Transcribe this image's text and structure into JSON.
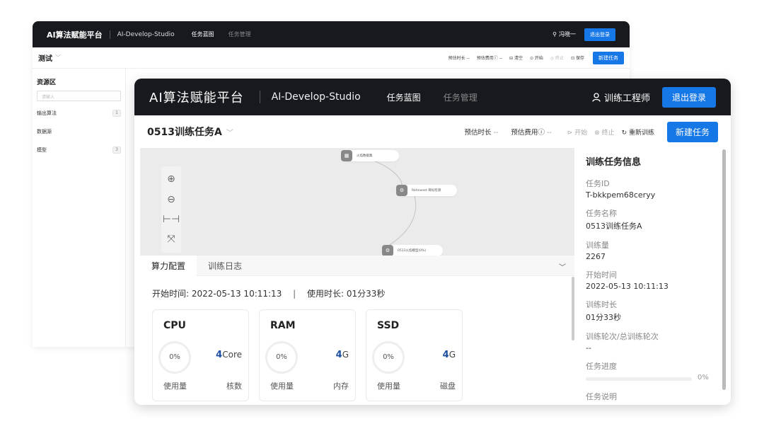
{
  "back": {
    "brand": "AI算法赋能平台",
    "studio": "AI-Develop-Studio",
    "nav": [
      "任务蓝图",
      "任务管理"
    ],
    "user": "冯晓一",
    "logout": "退出登录",
    "project": "测试",
    "toolbar": {
      "duration": "预估时长 --",
      "cost": "预估费用ⓘ --",
      "clear": "⊟ 清空",
      "start": "⊙ 开始",
      "stop": "◎ 终止",
      "save": "⊡ 保存",
      "new_task": "新建任务"
    },
    "sidebar": {
      "title": "资源区",
      "search_placeholder": "请输入",
      "items": [
        {
          "label": "输出算法",
          "count": "1"
        },
        {
          "label": "数据源",
          "count": ""
        },
        {
          "label": "模型",
          "count": "3"
        }
      ]
    }
  },
  "front": {
    "brand": "AI算法赋能平台",
    "studio": "AI-Develop-Studio",
    "nav": [
      "任务蓝图",
      "任务管理"
    ],
    "user": "训练工程师",
    "logout": "退出登录",
    "project": "0513训练任务A",
    "estimate": {
      "duration_label": "预估时长",
      "duration_value": "--",
      "cost_label": "预估费用ⓘ",
      "cost_value": "--"
    },
    "actions": {
      "start": "⊳ 开始",
      "stop": "⊗ 终止",
      "retrain": "↻ 重新训练",
      "new_task": "新建任务"
    },
    "nodes": [
      "火焰数据集",
      "Retinanet 目标检测",
      "0513火焰模型(0%)"
    ],
    "tabs": [
      "算力配置",
      "训练日志"
    ],
    "timeline": {
      "start_label": "开始时间:",
      "start_value": "2022-05-13 10:11:13",
      "sep": "|",
      "used_label": "使用时长:",
      "used_value": "01分33秒"
    },
    "cards": [
      {
        "title": "CPU",
        "usage": "0%",
        "capacity": "4",
        "unit": "Core",
        "usage_label": "使用量",
        "cap_label": "核数"
      },
      {
        "title": "RAM",
        "usage": "0%",
        "capacity": "4",
        "unit": "G",
        "usage_label": "使用量",
        "cap_label": "内存"
      },
      {
        "title": "SSD",
        "usage": "0%",
        "capacity": "4",
        "unit": "G",
        "usage_label": "使用量",
        "cap_label": "磁盘"
      }
    ],
    "info": {
      "title": "训练任务信息",
      "fields": [
        {
          "label": "任务ID",
          "value": "T-bkkpem68ceryy"
        },
        {
          "label": "任务名称",
          "value": "0513训练任务A"
        },
        {
          "label": "训练量",
          "value": "2267"
        },
        {
          "label": "开始时间",
          "value": "2022-05-13 10:11:13"
        },
        {
          "label": "训练时长",
          "value": "01分33秒"
        },
        {
          "label": "训练轮次/总训练轮次",
          "value": "--"
        }
      ],
      "progress_label": "任务进度",
      "progress_value": "0%",
      "progress_fraction": 0,
      "desc_label": "任务说明"
    }
  }
}
